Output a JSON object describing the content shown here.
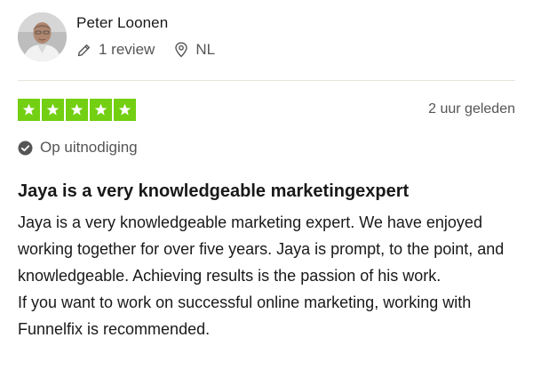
{
  "reviewer": {
    "name": "Peter Loonen",
    "review_count": "1 review",
    "country": "NL"
  },
  "review": {
    "rating": 5,
    "max_rating": 5,
    "date": "2 uur geleden",
    "verification_label": "Op uitnodiging",
    "title": "Jaya is a very knowledgeable marketingexpert",
    "body_paragraph_1": "Jaya is a very knowledgeable marketing expert. We have enjoyed working together for over five years. Jaya is prompt, to the point, and knowledgeable. Achieving results is the passion of his work.",
    "body_paragraph_2": "If you want to work on successful online marketing, working with Funnelfix is recommended."
  },
  "colors": {
    "star_green": "#73cf11",
    "text_primary": "#191919",
    "text_secondary": "#555555"
  },
  "icons": {
    "review_count": "pencil-icon",
    "country": "location-pin-icon",
    "verification": "check-circle-icon"
  }
}
